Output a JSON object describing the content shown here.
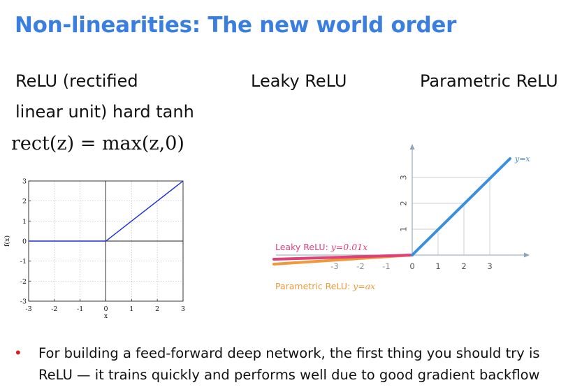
{
  "slide": {
    "title": "Non-linearities: The new world order",
    "columns": {
      "relu_heading_line1": "ReLU (rectified",
      "relu_heading_line2": "linear unit) hard tanh",
      "leaky_heading": "Leaky ReLU",
      "parametric_heading": "Parametric ReLU"
    },
    "formula": "rect(z) = max(z,0)",
    "bullet": {
      "text": "For building a feed-forward deep network, the first thing you should try is ReLU — it trains quickly and performs well due to good gradient backflow"
    }
  },
  "relu_plot": {
    "ylabel": "f(x)",
    "xlabel": "x",
    "x_ticks": [
      "-3",
      "-2",
      "-1",
      "0",
      "1",
      "2",
      "3"
    ],
    "y_ticks": [
      "3",
      "2",
      "1",
      "0",
      "-1",
      "-2",
      "-3"
    ],
    "line_color": "#1f2fd8",
    "points": [
      [
        -3,
        0
      ],
      [
        0,
        0
      ],
      [
        3,
        3
      ]
    ]
  },
  "leaky_plot": {
    "x_ticks": [
      "-3",
      "-2",
      "-1",
      "0",
      "1",
      "2",
      "3"
    ],
    "y_ticks": [
      "1",
      "2",
      "3"
    ],
    "identity_label": "y=x",
    "leaky_label_prefix": "Leaky ReLU: ",
    "leaky_label_eq": "y=0.01x",
    "parametric_label_prefix": "Parametric ReLU: ",
    "parametric_label_eq": "y=ax",
    "colors": {
      "identity": "#3b8fe0",
      "leaky": "#e0407a",
      "parametric": "#ef9a3a",
      "axis": "#8fa3b8",
      "grid": "#c8ced6"
    }
  }
}
